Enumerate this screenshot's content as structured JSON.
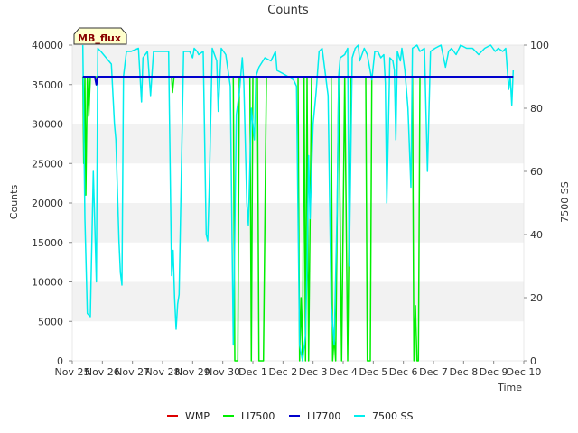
{
  "chart_data": {
    "type": "line",
    "title": "Counts",
    "xlabel": "Time",
    "ylabel": "Counts",
    "y2label": "7500 SS",
    "badge": "MB_flux",
    "ylim": [
      0,
      40000
    ],
    "y2lim": [
      0,
      100
    ],
    "xlim": [
      0,
      15
    ],
    "yticks": [
      0,
      5000,
      10000,
      15000,
      20000,
      25000,
      30000,
      35000,
      40000
    ],
    "y2ticks": [
      0,
      20,
      40,
      60,
      80,
      100
    ],
    "xticks": [
      {
        "x": 0,
        "label": "Nov 25"
      },
      {
        "x": 1,
        "label": "Nov 26"
      },
      {
        "x": 2,
        "label": "Nov 27"
      },
      {
        "x": 3,
        "label": "Nov 28"
      },
      {
        "x": 4,
        "label": "Nov 29"
      },
      {
        "x": 5,
        "label": "Nov 30"
      },
      {
        "x": 6,
        "label": "Dec 1"
      },
      {
        "x": 7,
        "label": "Dec 2"
      },
      {
        "x": 8,
        "label": "Dec 3"
      },
      {
        "x": 9,
        "label": "Dec 4"
      },
      {
        "x": 10,
        "label": "Dec 5"
      },
      {
        "x": 11,
        "label": "Dec 6"
      },
      {
        "x": 12,
        "label": "Dec 7"
      },
      {
        "x": 13,
        "label": "Dec 8"
      },
      {
        "x": 14,
        "label": "Dec 9"
      },
      {
        "x": 15,
        "label": "Dec 10"
      }
    ],
    "grid_bands": true,
    "legend_position": "bottom",
    "series": [
      {
        "name": "WMP",
        "color": "#dd0000",
        "axis": "left",
        "points": []
      },
      {
        "name": "LI7500",
        "color": "#00ee00",
        "axis": "left",
        "points": [
          [
            0.35,
            36000
          ],
          [
            0.38,
            25000
          ],
          [
            0.42,
            36000
          ],
          [
            0.45,
            21000
          ],
          [
            0.5,
            36000
          ],
          [
            0.55,
            31000
          ],
          [
            0.6,
            36000
          ],
          [
            3.3,
            36000
          ],
          [
            3.33,
            34000
          ],
          [
            3.38,
            36000
          ],
          [
            5.35,
            36000
          ],
          [
            5.4,
            0
          ],
          [
            5.5,
            0
          ],
          [
            5.55,
            36000
          ],
          [
            5.9,
            36000
          ],
          [
            5.95,
            0
          ],
          [
            6.0,
            36000
          ],
          [
            6.15,
            36000
          ],
          [
            6.2,
            0
          ],
          [
            6.35,
            0
          ],
          [
            6.45,
            36000
          ],
          [
            7.5,
            36000
          ],
          [
            7.55,
            0
          ],
          [
            7.6,
            8000
          ],
          [
            7.65,
            0
          ],
          [
            7.7,
            36000
          ],
          [
            7.75,
            0
          ],
          [
            7.8,
            36000
          ],
          [
            7.85,
            0
          ],
          [
            7.95,
            36000
          ],
          [
            8.6,
            36000
          ],
          [
            8.65,
            0
          ],
          [
            8.7,
            3000
          ],
          [
            8.75,
            0
          ],
          [
            8.85,
            36000
          ],
          [
            8.95,
            0
          ],
          [
            9.05,
            36000
          ],
          [
            9.15,
            0
          ],
          [
            9.25,
            36000
          ],
          [
            9.75,
            36000
          ],
          [
            9.8,
            0
          ],
          [
            9.9,
            0
          ],
          [
            9.95,
            36000
          ],
          [
            11.3,
            36000
          ],
          [
            11.35,
            0
          ],
          [
            11.4,
            7000
          ],
          [
            11.45,
            0
          ],
          [
            11.5,
            0
          ],
          [
            11.55,
            36000
          ],
          [
            14.65,
            36000
          ]
        ]
      },
      {
        "name": "LI7700",
        "color": "#0000cc",
        "axis": "left",
        "points": [
          [
            0.35,
            36000
          ],
          [
            0.75,
            36000
          ],
          [
            0.8,
            35000
          ],
          [
            0.85,
            36000
          ],
          [
            14.65,
            36000
          ]
        ]
      },
      {
        "name": "7500 SS",
        "color": "#00eeee",
        "axis": "right",
        "points": [
          [
            0.35,
            100
          ],
          [
            0.42,
            45
          ],
          [
            0.5,
            15
          ],
          [
            0.6,
            14
          ],
          [
            0.7,
            60
          ],
          [
            0.8,
            25
          ],
          [
            0.85,
            99
          ],
          [
            0.95,
            98
          ],
          [
            1.3,
            94
          ],
          [
            1.4,
            75
          ],
          [
            1.45,
            70
          ],
          [
            1.55,
            38
          ],
          [
            1.6,
            28
          ],
          [
            1.65,
            24
          ],
          [
            1.7,
            90
          ],
          [
            1.8,
            98
          ],
          [
            1.95,
            98
          ],
          [
            2.2,
            99
          ],
          [
            2.3,
            82
          ],
          [
            2.35,
            96
          ],
          [
            2.5,
            98
          ],
          [
            2.6,
            84
          ],
          [
            2.7,
            98
          ],
          [
            2.95,
            98
          ],
          [
            3.2,
            98
          ],
          [
            3.3,
            27
          ],
          [
            3.35,
            35
          ],
          [
            3.4,
            20
          ],
          [
            3.45,
            10
          ],
          [
            3.5,
            18
          ],
          [
            3.55,
            21
          ],
          [
            3.7,
            98
          ],
          [
            3.9,
            98
          ],
          [
            4.0,
            96
          ],
          [
            4.05,
            99
          ],
          [
            4.15,
            98
          ],
          [
            4.2,
            97
          ],
          [
            4.35,
            98
          ],
          [
            4.45,
            40
          ],
          [
            4.5,
            38
          ],
          [
            4.55,
            55
          ],
          [
            4.65,
            99
          ],
          [
            4.8,
            95
          ],
          [
            4.85,
            79
          ],
          [
            4.95,
            99
          ],
          [
            5.1,
            97
          ],
          [
            5.25,
            87
          ],
          [
            5.35,
            5
          ],
          [
            5.45,
            78
          ],
          [
            5.55,
            85
          ],
          [
            5.65,
            96
          ],
          [
            5.7,
            88
          ],
          [
            5.8,
            50
          ],
          [
            5.85,
            43
          ],
          [
            5.95,
            80
          ],
          [
            6.05,
            70
          ],
          [
            6.1,
            90
          ],
          [
            6.2,
            93
          ],
          [
            6.4,
            96
          ],
          [
            6.6,
            95
          ],
          [
            6.75,
            98
          ],
          [
            6.8,
            92
          ],
          [
            7.0,
            91
          ],
          [
            7.35,
            89
          ],
          [
            7.45,
            87
          ],
          [
            7.55,
            5
          ],
          [
            7.65,
            0
          ],
          [
            7.75,
            8
          ],
          [
            7.8,
            30
          ],
          [
            7.85,
            65
          ],
          [
            7.9,
            45
          ],
          [
            8.0,
            75
          ],
          [
            8.1,
            85
          ],
          [
            8.2,
            98
          ],
          [
            8.3,
            99
          ],
          [
            8.5,
            84
          ],
          [
            8.6,
            18
          ],
          [
            8.7,
            5
          ],
          [
            8.8,
            48
          ],
          [
            8.85,
            90
          ],
          [
            8.9,
            96
          ],
          [
            9.05,
            97
          ],
          [
            9.15,
            99
          ],
          [
            9.2,
            30
          ],
          [
            9.3,
            96
          ],
          [
            9.4,
            99
          ],
          [
            9.5,
            100
          ],
          [
            9.55,
            95
          ],
          [
            9.7,
            99
          ],
          [
            9.8,
            97
          ],
          [
            9.95,
            89
          ],
          [
            10.05,
            98
          ],
          [
            10.15,
            98
          ],
          [
            10.25,
            96
          ],
          [
            10.35,
            97
          ],
          [
            10.4,
            88
          ],
          [
            10.45,
            50
          ],
          [
            10.55,
            96
          ],
          [
            10.65,
            95
          ],
          [
            10.7,
            92
          ],
          [
            10.75,
            70
          ],
          [
            10.8,
            98
          ],
          [
            10.9,
            95
          ],
          [
            10.95,
            99
          ],
          [
            11.05,
            92
          ],
          [
            11.15,
            80
          ],
          [
            11.25,
            55
          ],
          [
            11.3,
            99
          ],
          [
            11.45,
            100
          ],
          [
            11.55,
            98
          ],
          [
            11.7,
            99
          ],
          [
            11.8,
            60
          ],
          [
            11.9,
            98
          ],
          [
            12.05,
            99
          ],
          [
            12.25,
            100
          ],
          [
            12.4,
            93
          ],
          [
            12.5,
            98
          ],
          [
            12.6,
            99
          ],
          [
            12.75,
            97
          ],
          [
            12.9,
            100
          ],
          [
            13.1,
            99
          ],
          [
            13.3,
            99
          ],
          [
            13.5,
            97
          ],
          [
            13.7,
            99
          ],
          [
            13.9,
            100
          ],
          [
            14.05,
            98
          ],
          [
            14.15,
            99
          ],
          [
            14.3,
            98
          ],
          [
            14.4,
            99
          ],
          [
            14.5,
            86
          ],
          [
            14.55,
            90
          ],
          [
            14.6,
            81
          ],
          [
            14.65,
            92
          ]
        ]
      }
    ]
  }
}
